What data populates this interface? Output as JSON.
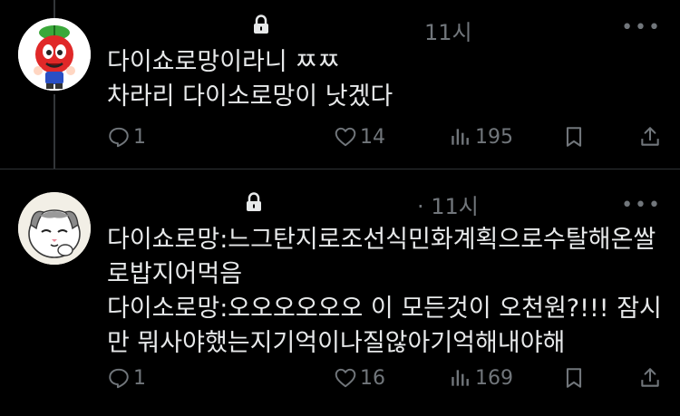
{
  "posts": [
    {
      "time": "11시",
      "text": "다이쇼로망이라니 ㅉㅉ\n차라리 다이소로망이 낫겠다",
      "replies": "1",
      "likes": "14",
      "views": "195",
      "avatar": "cherry-mascot-avatar"
    },
    {
      "time": "· 11시",
      "text": "다이쇼로망:느그탄지로조선식민화계획으로수탈해온쌀\n로밥지어먹음\n다이소로망:오오오오오오 이 모든것이 오천원?!!! 잠시\n만 뭐사야했는지기억이나질않아기억해내야해",
      "replies": "1",
      "likes": "16",
      "views": "169",
      "avatar": "cat-sticker-avatar"
    }
  ],
  "icons": {
    "lock": "lock-icon",
    "more": "more-icon",
    "reply": "reply-icon",
    "like": "heart-icon",
    "views": "views-icon",
    "bookmark": "bookmark-icon",
    "share": "share-icon"
  },
  "colors": {
    "background": "#000000",
    "text": "#e7e9ea",
    "muted": "#71767b",
    "line": "#333639"
  }
}
